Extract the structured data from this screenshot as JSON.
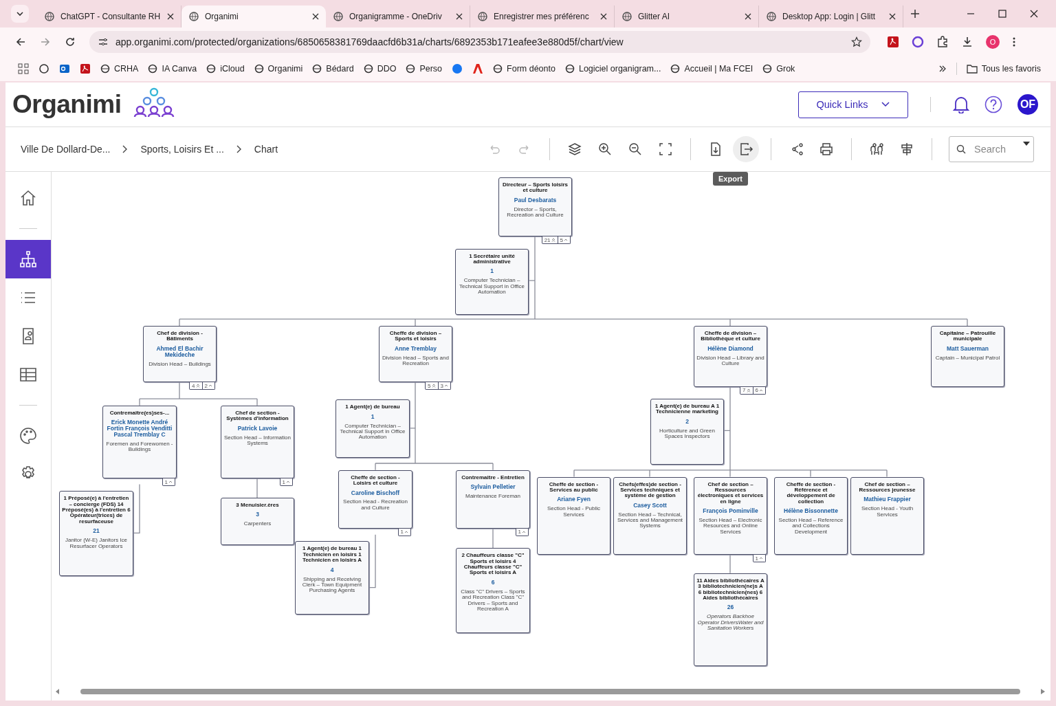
{
  "browser": {
    "tabs": [
      {
        "title": "ChatGPT - Consultante RH",
        "selected": false
      },
      {
        "title": "Organimi",
        "selected": true
      },
      {
        "title": "Organigramme - OneDriv",
        "selected": false
      },
      {
        "title": "Enregistrer mes préférenc",
        "selected": false
      },
      {
        "title": "Glitter AI",
        "selected": false
      },
      {
        "title": "Desktop App: Login | Glitt",
        "selected": false
      }
    ],
    "address": "app.organimi.com/protected/organizations/6850658381769daacfd6b31a/charts/6892353b171eafee3e880d5f/chart/view",
    "profile": "O",
    "bookmarks": [
      "CRHA",
      "IA Canva",
      "iCloud",
      "Organimi",
      "Bédard",
      "DDO",
      "Perso",
      "Form déonto",
      "Logiciel organigram...",
      "Accueil | Ma FCEI",
      "Grok"
    ],
    "all_bookmarks": "Tous les favoris"
  },
  "header": {
    "logo": "Organimi",
    "quick_links": "Quick Links",
    "avatar": "OF"
  },
  "breadcrumbs": [
    "Ville De Dollard-De...",
    "Sports, Loisirs Et ...",
    "Chart"
  ],
  "toolbar": [
    {
      "kind": "undo",
      "disabled": true,
      "hovered": false
    },
    {
      "kind": "redo",
      "disabled": true,
      "hovered": false
    },
    {
      "kind": "layers",
      "disabled": false,
      "hovered": false
    },
    {
      "kind": "zoom-in",
      "disabled": false,
      "hovered": false
    },
    {
      "kind": "zoom-out",
      "disabled": false,
      "hovered": false
    },
    {
      "kind": "fit",
      "disabled": false,
      "hovered": false
    },
    {
      "kind": "download",
      "disabled": false,
      "hovered": false
    },
    {
      "kind": "export",
      "disabled": false,
      "hovered": true
    },
    {
      "kind": "share",
      "disabled": false,
      "hovered": false
    },
    {
      "kind": "print",
      "disabled": false,
      "hovered": false
    },
    {
      "kind": "people",
      "disabled": false,
      "hovered": false
    },
    {
      "kind": "align",
      "disabled": false,
      "hovered": false
    }
  ],
  "tooltip": "Export",
  "search": {
    "placeholder": "Search"
  },
  "sidebar": [
    {
      "kind": "home",
      "selected": false
    },
    {
      "kind": "chart",
      "selected": true
    },
    {
      "kind": "list",
      "selected": false
    },
    {
      "kind": "directory",
      "selected": false
    },
    {
      "kind": "table",
      "selected": false
    },
    {
      "kind": "theme",
      "selected": false
    },
    {
      "kind": "settings",
      "selected": false
    }
  ],
  "chart": {
    "nodes": [
      {
        "title": "Directeur – Sports loisirs et culture",
        "name": "Paul Desbarats",
        "subtitle": "Director – Sports, Recreation and Culture",
        "italic": false,
        "badges": [
          {
            "kind": "total",
            "count": "21"
          },
          {
            "kind": "direct",
            "count": "5"
          }
        ]
      },
      {
        "title": "1 Secrétaire unité administrative",
        "name": "1",
        "subtitle": "Computer Technician – Technical Support in Office Automation",
        "italic": false
      },
      {
        "title": "Chef de division - Bâtiments",
        "name": "Ahmed El Bachir Mekideche",
        "subtitle": "Division Head – Buildings",
        "italic": false,
        "badges": [
          {
            "kind": "total",
            "count": "4"
          },
          {
            "kind": "direct",
            "count": "2"
          }
        ]
      },
      {
        "title": "Cheffe de division – Sports et loisirs",
        "name": "Anne Tremblay",
        "subtitle": "Division Head – Sports and Recreation",
        "italic": false,
        "badges": [
          {
            "kind": "total",
            "count": "5"
          },
          {
            "kind": "direct",
            "count": "3"
          }
        ]
      },
      {
        "title": "Cheffe de division – Bibliothèque et culture",
        "name": "Hélène Diamond",
        "subtitle": "Division Head – Library and Culture",
        "italic": false,
        "badges": [
          {
            "kind": "total",
            "count": "7"
          },
          {
            "kind": "direct",
            "count": "6"
          }
        ]
      },
      {
        "title": "Capitaine – Patrouille municipale",
        "name": "Matt Sauerman",
        "subtitle": "Captain – Municipal Patrol",
        "italic": false
      },
      {
        "title": "Contremaître(es)ses-...",
        "name": "Erick Monette André Fortin François Venditti Pascal Tremblay C",
        "subtitle": "Foremen and Forewomen - Buildings",
        "italic": false,
        "badges": [
          {
            "kind": "direct",
            "count": "1"
          }
        ]
      },
      {
        "title": "Chef de section - Systèmes d'information",
        "name": "Patrick Lavoie",
        "subtitle": "Section Head – Information Systems",
        "italic": false,
        "badges": [
          {
            "kind": "direct",
            "count": "1"
          }
        ]
      },
      {
        "title": "1 Préposé(e) à l'entretien – concierge (FDS) 14 Préposé(es) à l'entretien 6 Opérateur(trices) de resurfaceuse",
        "name": "21",
        "subtitle": "Janitor (W-E) Janitors Ice Resurfacer Operators",
        "italic": false
      },
      {
        "title": "3 Menuisier.ères",
        "name": "3",
        "subtitle": "Carpenters",
        "italic": false
      },
      {
        "title": "1 Agent(e) de bureau",
        "name": "1",
        "subtitle": "Computer Technician – Technical Support in Office Automation",
        "italic": false
      },
      {
        "title": "Cheffe de section - Loisirs et culture",
        "name": "Caroline Bischoff",
        "subtitle": "Section Head - Recreation and Culture",
        "italic": false,
        "badges": [
          {
            "kind": "direct",
            "count": "1"
          }
        ]
      },
      {
        "title": "Contremaitre - Entretien",
        "name": "Sylvain Pelletier",
        "subtitle": "Maintenance Foreman",
        "italic": false,
        "badges": [
          {
            "kind": "direct",
            "count": "1"
          }
        ]
      },
      {
        "title": "1 Agent(e) de bureau 1 Technicien en loisirs 1 Technicien en loisirs A",
        "name": "4",
        "subtitle": "Shipping and Receiving Clerk – Town Equipment Purchasing Agents",
        "italic": false
      },
      {
        "title": "2 Chauffeurs classe \"C\" Sports et loisirs 4 Chauffeurs classe \"C\" Sports et loisirs A",
        "name": "6",
        "subtitle": "Class \"C\" Drivers – Sports and Recreation Class \"C\" Drivers – Sports and Recreation A",
        "italic": false
      },
      {
        "title": "1 Agent(e) de bureau A 1 Technicienne marketing",
        "name": "2",
        "subtitle": "Horticulture and Green Spaces Inspectors",
        "italic": false
      },
      {
        "title": "Cheffe de section - Services au public",
        "name": "Ariane Fyen",
        "subtitle": "Section Head - Public Services",
        "italic": false
      },
      {
        "title": "Chefs(effes)de section - Services techniques et système de gestion",
        "name": "Casey Scott",
        "subtitle": "Section Head – Technical, Services and Management Systems",
        "italic": false
      },
      {
        "title": "Chef de section – Ressources électroniques et services en ligne",
        "name": "François Pominville",
        "subtitle": "Section Head – Electronic Resources and Online Services",
        "italic": false,
        "badges": [
          {
            "kind": "direct",
            "count": "1"
          }
        ]
      },
      {
        "title": "Cheffe de section - Référence et développement de collection",
        "name": "Hélène Bissonnette",
        "subtitle": "Section Head – Reference and Collections Development",
        "italic": false
      },
      {
        "title": "Chef de section – Ressources jeunesse",
        "name": "Mathieu Frappier",
        "subtitle": "Section Head - Youth Services",
        "italic": false
      },
      {
        "title": "11 Aides bibliothécaires A 3 bibliotechnicien(ne)s A 6 bibliotechnicien(nes) 6 Aides bibliothécaires",
        "name": "26",
        "subtitle": "Operators Backhoe Operator DriversWater and Sanitation Workers",
        "italic": true
      }
    ]
  }
}
